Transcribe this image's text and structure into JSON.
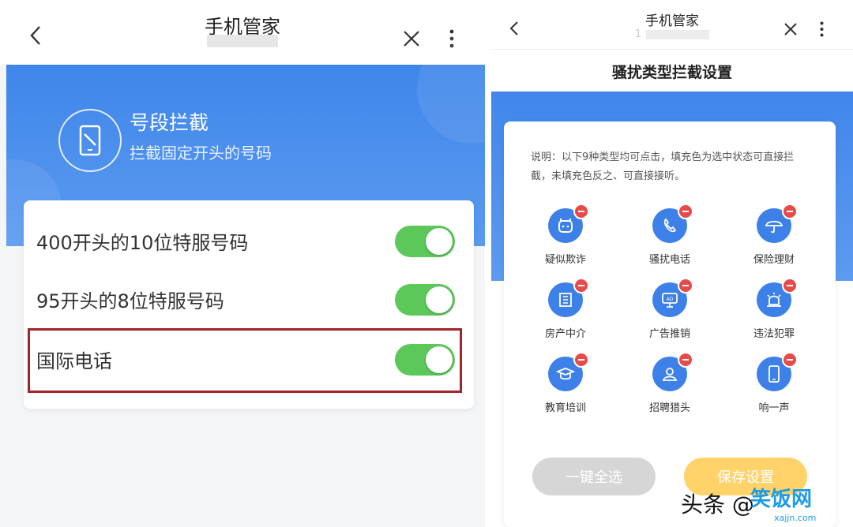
{
  "left": {
    "nav": {
      "title": "手机管家"
    },
    "hero": {
      "title": "号段拦截",
      "subtitle": "拦截固定开头的号码"
    },
    "rows": [
      {
        "label": "400开头的10位特服号码",
        "enabled": true
      },
      {
        "label": "95开头的8位特服号码",
        "enabled": true
      },
      {
        "label": "国际电话",
        "enabled": true
      }
    ]
  },
  "right": {
    "nav": {
      "title": "手机管家",
      "subtitle": "1"
    },
    "header": "骚扰类型拦截设置",
    "description": "说明：以下9种类型均可点击，填充色为选中状态可直接拦截，未填充色反之、可直接接听。",
    "items": [
      {
        "label": "疑似欺诈",
        "icon": "face-icon"
      },
      {
        "label": "骚扰电话",
        "icon": "phone-icon"
      },
      {
        "label": "保险理财",
        "icon": "umbrella-icon"
      },
      {
        "label": "房产中介",
        "icon": "building-icon"
      },
      {
        "label": "广告推销",
        "icon": "ad-icon"
      },
      {
        "label": "违法犯罪",
        "icon": "siren-icon"
      },
      {
        "label": "教育培训",
        "icon": "graduation-icon"
      },
      {
        "label": "招聘猎头",
        "icon": "person-icon"
      },
      {
        "label": "响一声",
        "icon": "mobile-icon"
      }
    ],
    "buttons": {
      "select_all": "一键全选",
      "save": "保存设置"
    }
  },
  "watermark": {
    "text": "头条 @",
    "logo": "笑饭网",
    "url": "xajjn.com"
  },
  "colors": {
    "accent_blue": "#3f86ea",
    "toggle_green": "#5cc85a",
    "highlight_red": "#a3242a",
    "badge_red": "#e84a4a",
    "save_orange": "#ffd36a"
  }
}
